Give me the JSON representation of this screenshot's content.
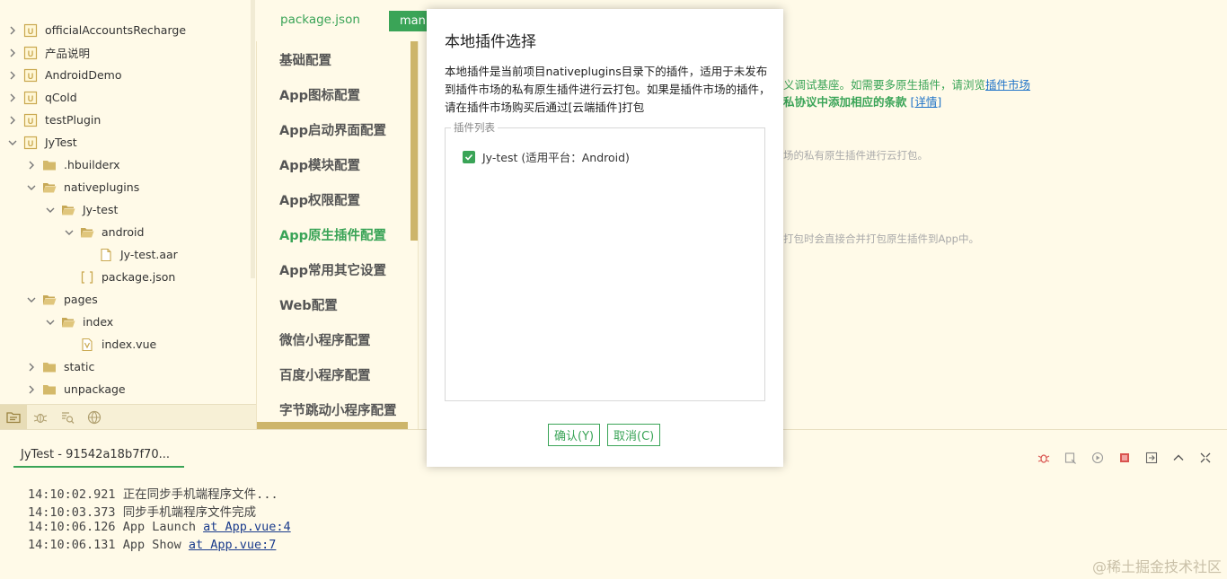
{
  "tree": {
    "items": [
      {
        "label": "officialAccountsRecharge",
        "type": "project"
      },
      {
        "label": "产品说明",
        "type": "project"
      },
      {
        "label": "AndroidDemo",
        "type": "project"
      },
      {
        "label": "qCold",
        "type": "project"
      },
      {
        "label": "testPlugin",
        "type": "project"
      },
      {
        "label": "JyTest",
        "type": "project"
      },
      {
        "label": ".hbuilderx",
        "type": "folder"
      },
      {
        "label": "nativeplugins",
        "type": "folder"
      },
      {
        "label": "Jy-test",
        "type": "folder"
      },
      {
        "label": "android",
        "type": "folder"
      },
      {
        "label": "Jy-test.aar",
        "type": "file"
      },
      {
        "label": "package.json",
        "type": "json"
      },
      {
        "label": "pages",
        "type": "folder"
      },
      {
        "label": "index",
        "type": "folder"
      },
      {
        "label": "index.vue",
        "type": "vue"
      },
      {
        "label": "static",
        "type": "folder"
      },
      {
        "label": "unpackage",
        "type": "folder"
      }
    ]
  },
  "editor_tabs": {
    "package_label": "package.json",
    "manifest_label": "mani"
  },
  "manifest_nav": {
    "items": [
      "基础配置",
      "App图标配置",
      "App启动界面配置",
      "App模块配置",
      "App权限配置",
      "App原生插件配置",
      "App常用其它设置",
      "Web配置",
      "微信小程序配置",
      "百度小程序配置",
      "字节跳动小程序配置"
    ],
    "active": "App原生插件配置"
  },
  "content": {
    "line1_text": "义调试基座。如需要多原生插件，请浏览",
    "line1_link": "插件市场",
    "line2_text": "私协议中添加相应的条款",
    "line2_link": "[详情]",
    "line3_text": "场的私有原生插件进行云打包。",
    "line4_text": "打包时会直接合并打包原生插件到App中。"
  },
  "console": {
    "tab_label": "JyTest - 91542a18b7f70...",
    "logs": [
      {
        "time": "14:10:02.921",
        "text": "正在同步手机端程序文件...",
        "link": ""
      },
      {
        "time": "14:10:03.373",
        "text": "同步手机端程序文件完成",
        "link": ""
      },
      {
        "time": "14:10:06.126",
        "text": "App Launch",
        "link": "at App.vue:4"
      },
      {
        "time": "14:10:06.131",
        "text": "App Show",
        "link": "at App.vue:7"
      }
    ],
    "watermark": "@稀土掘金技术社区"
  },
  "modal": {
    "title": "本地插件选择",
    "description": "本地插件是当前项目nativeplugins目录下的插件，适用于未发布到插件市场的私有原生插件进行云打包。如果是插件市场的插件，请在插件市场购买后通过[云端插件]打包",
    "group_label": "插件列表",
    "plugin_label": "Jy-test (适用平台：Android)",
    "plugin_checked": true,
    "ok_label": "确认(Y)",
    "cancel_label": "取消(C)"
  },
  "colors": {
    "accent": "#3aa457",
    "background": "#fffae8",
    "scrollbar": "#cdb56a",
    "link": "#1f73c8"
  }
}
